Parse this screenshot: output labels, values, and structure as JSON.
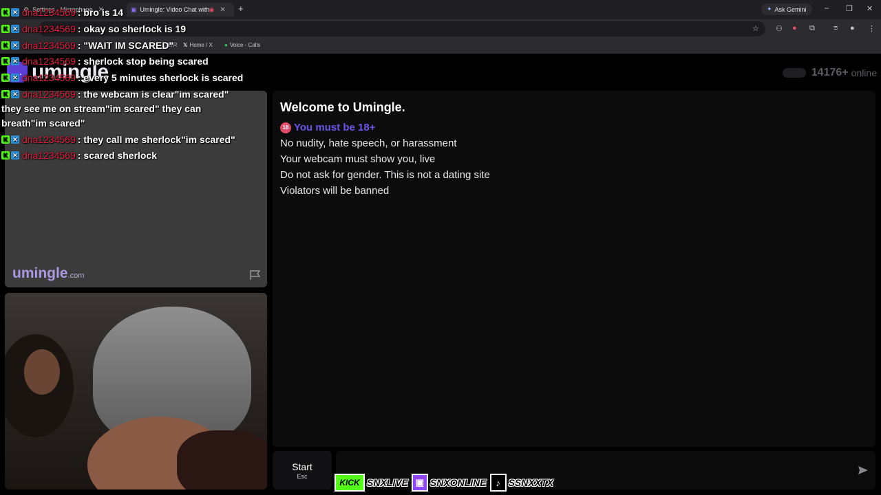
{
  "browser": {
    "tabs": [
      {
        "label": "Settings - Microphone",
        "active": false
      },
      {
        "label": "Umingle: Video Chat with S",
        "active": true
      }
    ],
    "new_tab": "+",
    "gemini_label": "Ask Gemini",
    "bookmarks": [
      "ATR",
      "Home / X",
      "Voice - Calls"
    ],
    "window_controls": [
      "–",
      "❐",
      "✕"
    ]
  },
  "site": {
    "logo_text": "umingle",
    "online_count": "14176+",
    "online_label": "online",
    "watermark_main": "umingle",
    "watermark_tld": ".com"
  },
  "chat": {
    "welcome": "Welcome to Umingle.",
    "age_warning": "You must be 18+",
    "age_icon_text": "18",
    "rules": [
      "No nudity, hate speech, or harassment",
      "Your webcam must show you, live",
      "Do not ask for gender. This is not a dating site",
      "Violators will be banned"
    ],
    "input_placeholder": ""
  },
  "controls": {
    "start_label": "Start",
    "start_key": "Esc"
  },
  "stream_overlay": {
    "messages": [
      {
        "user": "dna1234569",
        "text": ": bro is 14"
      },
      {
        "user": "dna1234569",
        "text": ": okay so sherlock is 19"
      },
      {
        "user": "dna1234569",
        "text": ": \"WAIT IM SCARED\""
      },
      {
        "user": "dna1234569",
        "text": ": sherlock stop being scared"
      },
      {
        "user": "dna1234569",
        "text": ": every 5 minutes sherlock is scared"
      },
      {
        "user": "dna1234569",
        "text": ": the webcam is clear\"im scared\""
      },
      {
        "user": "dna1234569",
        "text": ": they call me sherlock\"im scared\""
      },
      {
        "user": "dna1234569",
        "text": ": scared sherlock"
      }
    ],
    "wrapped_continuation": "they see me on stream\"im scared\" they can breath\"im scared\"",
    "badge_k": "K",
    "badge_b": "✕"
  },
  "socials": {
    "kick_badge": "KICK",
    "kick_name": "SNXLIVE",
    "twitch_name": "SNXONLINE",
    "tiktok_name": "SSNXXTX",
    "twitch_icon": "▣",
    "tiktok_icon": "♪"
  },
  "colors": {
    "accent": "#5b3fd6",
    "age_warning": "#6a55e6",
    "kick_green": "#53fc18",
    "overlay_username": "#e0203f"
  }
}
